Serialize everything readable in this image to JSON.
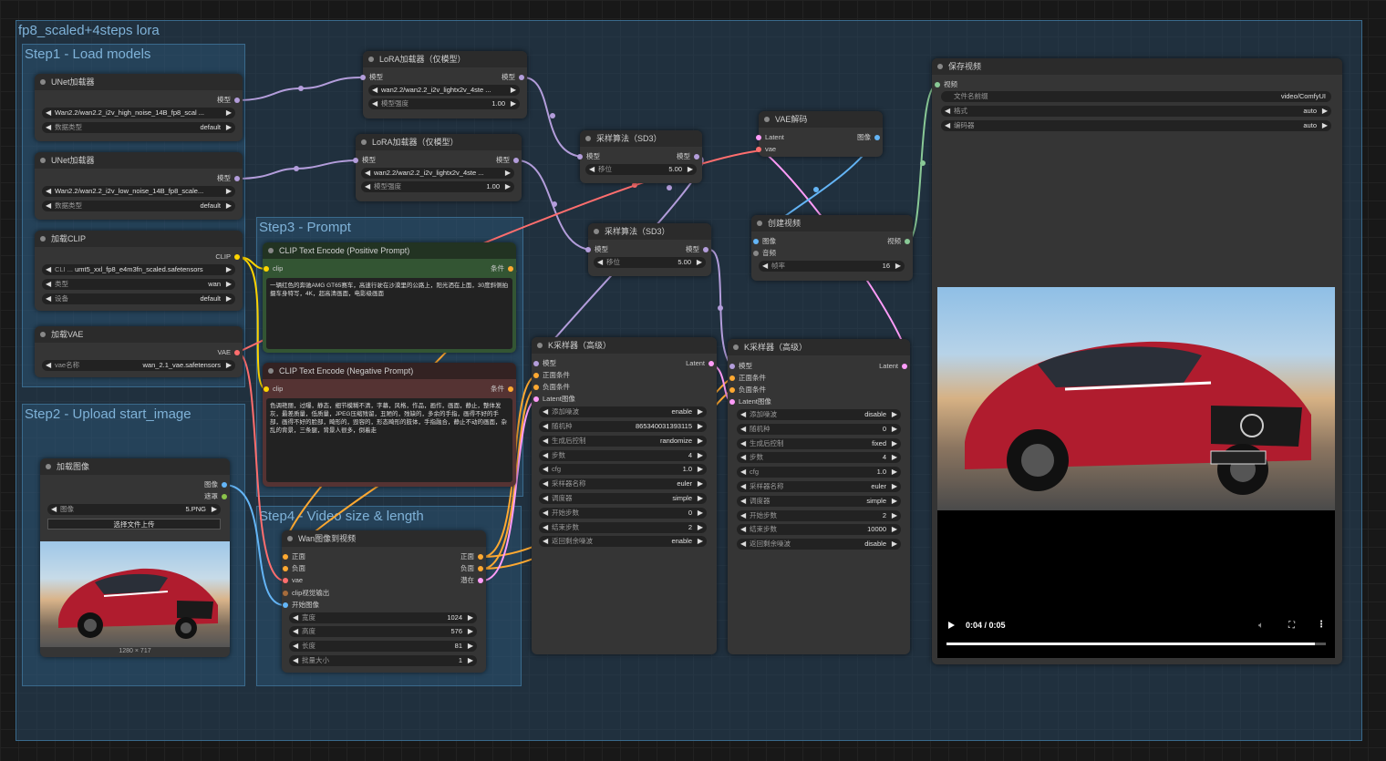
{
  "workflow": {
    "group_main": "fp8_scaled+4steps lora",
    "group_step1": "Step1 - Load models",
    "group_step2": "Step2 - Upload start_image",
    "group_step3": "Step3 - Prompt",
    "group_step4": "Step4 - Video size & length"
  },
  "unet1": {
    "title": "UNet加载器",
    "out_model": "模型",
    "w_name": "Wan2.2/wan2.2_i2v_high_noise_14B_fp8_scal ...",
    "w_dtype_lbl": "数据类型",
    "w_dtype": "default"
  },
  "unet2": {
    "title": "UNet加载器",
    "out_model": "模型",
    "w_name": "Wan2.2/wan2.2_i2v_low_noise_14B_fp8_scale...",
    "w_dtype_lbl": "数据类型",
    "w_dtype": "default"
  },
  "clip_loader": {
    "title": "加载CLIP",
    "out": "CLIP",
    "w_name_lbl": "CLI ...",
    "w_name": "umt5_xxl_fp8_e4m3fn_scaled.safetensors",
    "w_type_lbl": "类型",
    "w_type": "wan",
    "w_dev_lbl": "设备",
    "w_dev": "default"
  },
  "vae_loader": {
    "title": "加载VAE",
    "out": "VAE",
    "w_name_lbl": "vae名称",
    "w_name": "wan_2.1_vae.safetensors"
  },
  "lora1": {
    "title": "LoRA加载器（仅模型）",
    "in_model": "模型",
    "out_model": "模型",
    "w_name": "wan2.2/wan2.2_i2v_lightx2v_4ste ...",
    "w_str_lbl": "模型强度",
    "w_str": "1.00"
  },
  "lora2": {
    "title": "LoRA加载器（仅模型）",
    "in_model": "模型",
    "out_model": "模型",
    "w_name": "wan2.2/wan2.2_i2v_lightx2v_4ste ...",
    "w_str_lbl": "模型强度",
    "w_str": "1.00"
  },
  "sd3_1": {
    "title": "采样算法（SD3）",
    "in_model": "模型",
    "out_model": "模型",
    "w_shift_lbl": "移位",
    "w_shift": "5.00"
  },
  "sd3_2": {
    "title": "采样算法（SD3）",
    "in_model": "模型",
    "out_model": "模型",
    "w_shift_lbl": "移位",
    "w_shift": "5.00"
  },
  "vae_decode": {
    "title": "VAE解码",
    "in_latent": "Latent",
    "in_vae": "vae",
    "out": "图像"
  },
  "create_video": {
    "title": "创建视频",
    "in_images": "图像",
    "in_audio": "音频",
    "out": "视频",
    "w_fps_lbl": "帧率",
    "w_fps": "16"
  },
  "save_video": {
    "title": "保存视频",
    "in_video": "视频",
    "w_prefix_lbl": "文件名前缀",
    "w_prefix": "video/ComfyUI",
    "w_format_lbl": "格式",
    "w_format": "auto",
    "w_codec_lbl": "编码器",
    "w_codec": "auto",
    "player_time": "0:04 / 0:05",
    "progress": 0.97
  },
  "clip_pos": {
    "title": "CLIP Text Encode (Positive Prompt)",
    "in": "clip",
    "out": "条件",
    "text": "一辆红色的奔驰AMG GT65赛车，高速行驶在沙漠里的公路上，阳光洒在上面，30度斜侧拍摄车身特写，4K，超高清画面，电影级画面"
  },
  "clip_neg": {
    "title": "CLIP Text Encode (Negative Prompt)",
    "in": "clip",
    "out": "条件",
    "text": "色调艳丽，过曝，静态，细节模糊不清，字幕，风格，作品，画作，画面，静止，整体发灰，最差质量，低质量，JPEG压缩残留，丑陋的，残缺的，多余的手指，画得不好的手部，画得不好的脸部，畸形的，毁容的，形态畸形的肢体，手指融合，静止不动的画面，杂乱的背景，三条腿，背景人很多，倒着走"
  },
  "load_image": {
    "title": "加载图像",
    "out_image": "图像",
    "out_mask": "遮罩",
    "w_image_lbl": "图像",
    "w_image": "5.PNG",
    "upload": "选择文件上传",
    "dims": "1280 × 717"
  },
  "wan_i2v": {
    "title": "Wan图像到视频",
    "in_pos": "正面",
    "in_neg": "负面",
    "in_vae": "vae",
    "in_clipvision": "clip视觉输出",
    "in_start": "开始图像",
    "out_pos": "正面",
    "out_neg": "负面",
    "out_latent": "潜在",
    "w_width_lbl": "宽度",
    "w_width": "1024",
    "w_height_lbl": "高度",
    "w_height": "576",
    "w_length_lbl": "长度",
    "w_length": "81",
    "w_batch_lbl": "批量大小",
    "w_batch": "1"
  },
  "ks1": {
    "title": "K采样器（高级）",
    "in_model": "模型",
    "in_pos": "正面条件",
    "in_neg": "负面条件",
    "in_latent": "Latent图像",
    "out": "Latent",
    "rows": [
      {
        "lbl": "添加噪波",
        "val": "enable"
      },
      {
        "lbl": "随机种",
        "val": "865340031393115"
      },
      {
        "lbl": "生成后控制",
        "val": "randomize"
      },
      {
        "lbl": "步数",
        "val": "4"
      },
      {
        "lbl": "cfg",
        "val": "1.0"
      },
      {
        "lbl": "采样器名称",
        "val": "euler"
      },
      {
        "lbl": "调度器",
        "val": "simple"
      },
      {
        "lbl": "开始步数",
        "val": "0"
      },
      {
        "lbl": "结束步数",
        "val": "2"
      },
      {
        "lbl": "返回剩余噪波",
        "val": "enable"
      }
    ]
  },
  "ks2": {
    "title": "K采样器（高级）",
    "in_model": "模型",
    "in_pos": "正面条件",
    "in_neg": "负面条件",
    "in_latent": "Latent图像",
    "out": "Latent",
    "rows": [
      {
        "lbl": "添加噪波",
        "val": "disable"
      },
      {
        "lbl": "随机种",
        "val": "0"
      },
      {
        "lbl": "生成后控制",
        "val": "fixed"
      },
      {
        "lbl": "步数",
        "val": "4"
      },
      {
        "lbl": "cfg",
        "val": "1.0"
      },
      {
        "lbl": "采样器名称",
        "val": "euler"
      },
      {
        "lbl": "调度器",
        "val": "simple"
      },
      {
        "lbl": "开始步数",
        "val": "2"
      },
      {
        "lbl": "结束步数",
        "val": "10000"
      },
      {
        "lbl": "返回剩余噪波",
        "val": "disable"
      }
    ]
  },
  "colors": {
    "model": "#b39ddb",
    "clip": "#ffd500",
    "vae": "#ff6e6e",
    "cond": "#ffa931",
    "latent": "#ff9cf9",
    "image": "#64b5f6",
    "video": "#89c996"
  }
}
